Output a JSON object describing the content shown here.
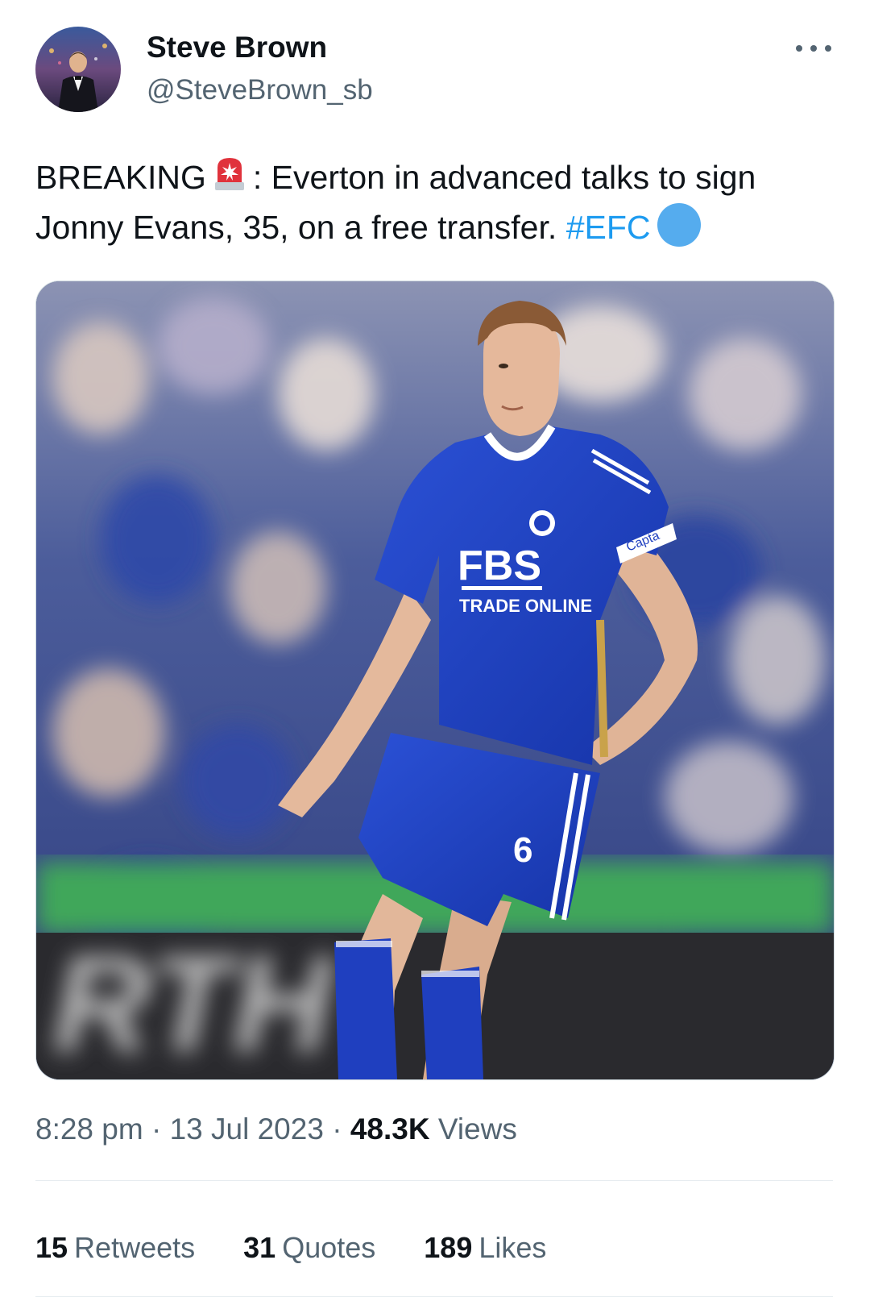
{
  "author": {
    "display_name": "Steve Brown",
    "handle": "@SteveBrown_sb"
  },
  "tweet": {
    "text_before": "BREAKING",
    "siren_icon": "rotating-light-emoji",
    "text_main": ": Everton in advanced talks to sign Jonny Evans, 35, on a free transfer.",
    "hashtag": "#EFC",
    "trailing_icon": "blue-circle-emoji"
  },
  "media": {
    "shirt_sponsor": "FBS",
    "shirt_sponsor_sub": "TRADE ONLINE",
    "shirt_number": "6",
    "armband": "Capta",
    "board_text": "RTH"
  },
  "meta": {
    "time": "8:28 pm",
    "separator": "·",
    "date": "13 Jul 2023",
    "views_count": "48.3K",
    "views_label": "Views"
  },
  "stats": {
    "retweets_count": "15",
    "retweets_label": "Retweets",
    "quotes_count": "31",
    "quotes_label": "Quotes",
    "likes_count": "189",
    "likes_label": "Likes"
  },
  "colors": {
    "link": "#1d9bf0",
    "secondary_text": "#536471",
    "primary_text": "#0f1419",
    "kit_blue": "#1f3fbf"
  }
}
